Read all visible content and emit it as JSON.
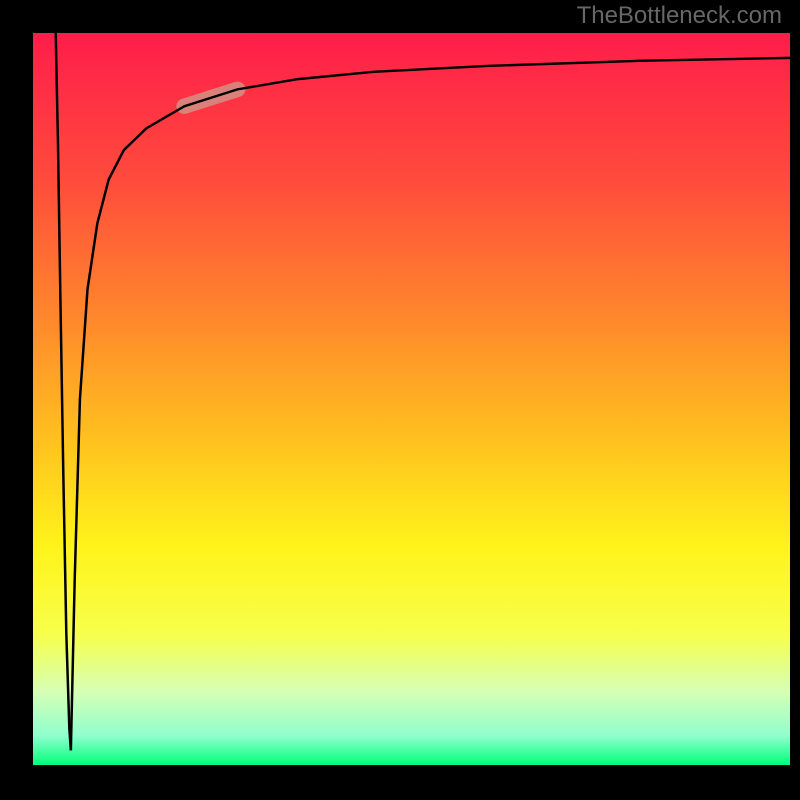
{
  "attribution": "TheBottleneck.com",
  "colors": {
    "gradient_stops": [
      {
        "offset": 0.0,
        "color": "#ff1d4a"
      },
      {
        "offset": 0.2,
        "color": "#ff4b3c"
      },
      {
        "offset": 0.4,
        "color": "#ff8b2b"
      },
      {
        "offset": 0.55,
        "color": "#ffbf1f"
      },
      {
        "offset": 0.7,
        "color": "#fff31a"
      },
      {
        "offset": 0.82,
        "color": "#f7ff4a"
      },
      {
        "offset": 0.9,
        "color": "#d6ffb5"
      },
      {
        "offset": 0.96,
        "color": "#8fffce"
      },
      {
        "offset": 1.0,
        "color": "#00ff7b"
      }
    ],
    "highlight": "#d38f84",
    "curve": "#000000",
    "frame": "#000000",
    "attribution_text": "#676767"
  },
  "chart_data": {
    "type": "line",
    "title": "",
    "xlabel": "",
    "ylabel": "",
    "xlim": [
      0,
      100
    ],
    "ylim": [
      0,
      100
    ],
    "grid": false,
    "legend": false,
    "series": [
      {
        "name": "bottleneck-curve-descending",
        "description": "Left branch falling sharply from top-left to bottom near x≈5",
        "x": [
          3.0,
          3.3,
          3.6,
          4.0,
          4.4,
          4.8,
          5.0
        ],
        "y": [
          100,
          85,
          65,
          40,
          18,
          5,
          2
        ]
      },
      {
        "name": "bottleneck-curve-ascending",
        "description": "Right branch rising sharply then asymptoting toward top-right",
        "x": [
          5.0,
          5.5,
          6.2,
          7.2,
          8.5,
          10,
          12,
          15,
          20,
          27,
          35,
          45,
          60,
          80,
          100
        ],
        "y": [
          2,
          25,
          50,
          65,
          74,
          80,
          84,
          87,
          90,
          92.3,
          93.7,
          94.7,
          95.5,
          96.2,
          96.6
        ]
      }
    ],
    "highlighted_segment": {
      "series": "bottleneck-curve-ascending",
      "x_range": [
        18,
        28
      ],
      "y_range": [
        87,
        92
      ]
    }
  }
}
